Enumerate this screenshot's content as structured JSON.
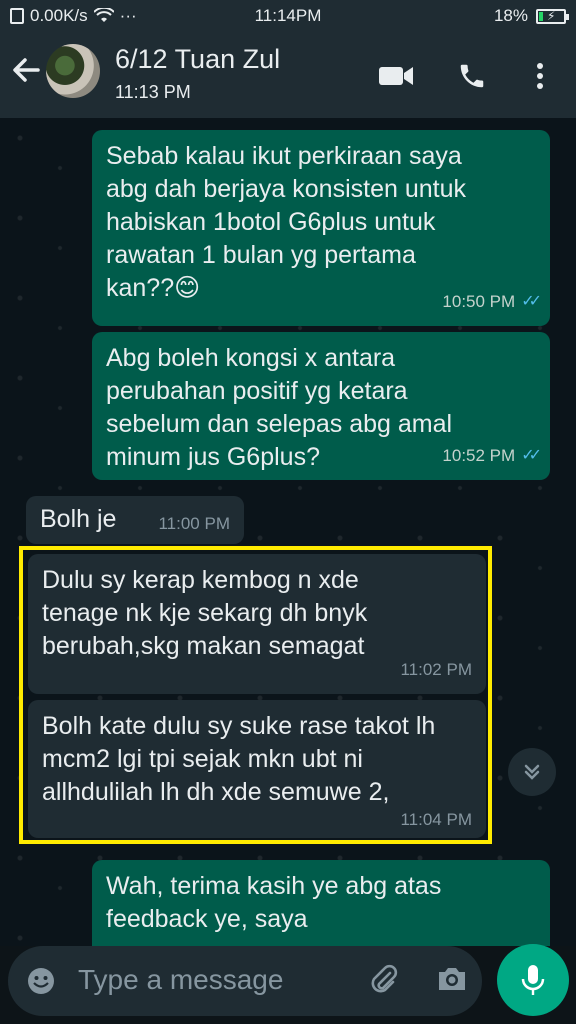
{
  "status_bar": {
    "network_speed": "0.00K/s",
    "dots": "···",
    "time": "11:14PM",
    "battery": "18%",
    "battery_level": 0.18
  },
  "header": {
    "back_icon": "arrow-left-icon",
    "contact_name": "6/12 Tuan Zul",
    "last_seen": "11:13 PM",
    "icons": [
      "video-call-icon",
      "phone-icon",
      "more-vert-icon"
    ]
  },
  "messages": [
    {
      "direction": "out",
      "lines": [
        "Sebab kalau ikut perkiraan saya",
        "abg dah berjaya konsisten untuk",
        "habiskan 1botol G6plus untuk",
        "rawatan 1 bulan yg pertama",
        "kan??😊"
      ],
      "time": "10:50 PM",
      "status": "read"
    },
    {
      "direction": "out",
      "lines": [
        "Abg boleh kongsi x antara",
        "perubahan positif yg ketara",
        "sebelum dan selepas abg amal",
        "minum jus G6plus?"
      ],
      "time": "10:52 PM",
      "status": "read"
    },
    {
      "direction": "in",
      "lines": [
        "Bolh je"
      ],
      "time": "11:00 PM"
    },
    {
      "direction": "in",
      "lines": [
        "Dulu sy kerap kembog n xde",
        "tenage nk kje sekarg dh bnyk",
        "berubah,skg makan semagat"
      ],
      "time": "11:02 PM"
    },
    {
      "direction": "in",
      "lines": [
        "Bolh kate dulu sy suke rase takot lh",
        "mcm2 lgi tpi sejak mkn ubt ni",
        "allhdulilah lh dh xde semuwe 2,"
      ],
      "time": "11:04 PM"
    },
    {
      "direction": "out",
      "lines": [
        "Wah, terima kasih ye abg atas",
        "feedback ye, saya"
      ],
      "time": ""
    }
  ],
  "input": {
    "placeholder": "Type a message",
    "icons": [
      "emoji-icon",
      "attach-icon",
      "camera-icon",
      "mic-icon"
    ]
  },
  "colors": {
    "outgoing_bubble": "#005c4b",
    "incoming_bubble": "#1f2c33",
    "highlight": "#ffeb00",
    "accent": "#00a884"
  }
}
